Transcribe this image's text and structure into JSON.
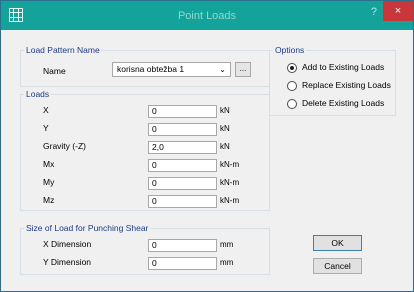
{
  "window": {
    "title": "Point Loads",
    "help": "?",
    "close": "×"
  },
  "load_pattern": {
    "group_title": "Load Pattern Name",
    "name_label": "Name",
    "selected": "korisna obtežba 1",
    "browse": "..."
  },
  "loads": {
    "group_title": "Loads",
    "rows": [
      {
        "label": "X",
        "value": "0",
        "unit": "kN"
      },
      {
        "label": "Y",
        "value": "0",
        "unit": "kN"
      },
      {
        "label": "Gravity (-Z)",
        "value": "2,0",
        "unit": "kN"
      },
      {
        "label": "Mx",
        "value": "0",
        "unit": "kN-m"
      },
      {
        "label": "My",
        "value": "0",
        "unit": "kN-m"
      },
      {
        "label": "Mz",
        "value": "0",
        "unit": "kN-m"
      }
    ]
  },
  "punching": {
    "group_title": "Size of Load for Punching Shear",
    "rows": [
      {
        "label": "X Dimension",
        "value": "0",
        "unit": "mm"
      },
      {
        "label": "Y Dimension",
        "value": "0",
        "unit": "mm"
      }
    ]
  },
  "options": {
    "group_title": "Options",
    "items": [
      {
        "label": "Add to Existing Loads",
        "checked": true
      },
      {
        "label": "Replace Existing Loads",
        "checked": false
      },
      {
        "label": "Delete Existing Loads",
        "checked": false
      }
    ]
  },
  "buttons": {
    "ok": "OK",
    "cancel": "Cancel"
  }
}
